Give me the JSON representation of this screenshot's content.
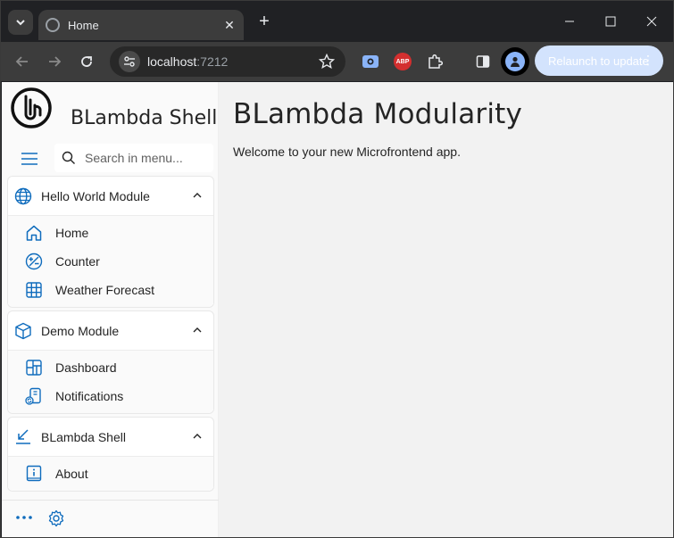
{
  "browser": {
    "tab_title": "Home",
    "tab_close": "✕",
    "new_tab": "+",
    "url_host": "localhost",
    "url_port": ":7212",
    "relaunch_label": "Relaunch to update",
    "abp_label": "ABP"
  },
  "app": {
    "title": "BLambda Shell",
    "search_placeholder": "Search in menu..."
  },
  "nav": {
    "groups": [
      {
        "label": "Hello World Module",
        "items": [
          {
            "label": "Home"
          },
          {
            "label": "Counter"
          },
          {
            "label": "Weather Forecast"
          }
        ]
      },
      {
        "label": "Demo Module",
        "items": [
          {
            "label": "Dashboard"
          },
          {
            "label": "Notifications"
          }
        ]
      },
      {
        "label": "BLambda Shell",
        "items": [
          {
            "label": "About"
          }
        ]
      }
    ]
  },
  "main": {
    "heading": "BLambda Modularity",
    "welcome": "Welcome to your new Microfrontend app."
  },
  "colors": {
    "accent": "#0f6cbd",
    "chrome_dark": "#202124",
    "toolbar": "#3c3c3c"
  }
}
